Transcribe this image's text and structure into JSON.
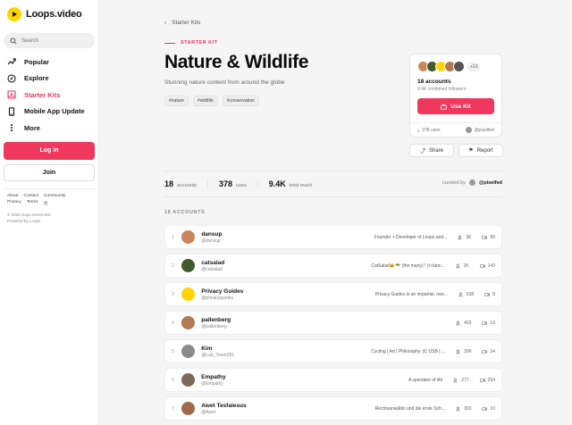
{
  "brand": {
    "name": "Loops.video",
    "accent": "#f0375d",
    "logo_color": "#ffd400"
  },
  "search": {
    "placeholder": "Search"
  },
  "nav": [
    {
      "label": "Popular",
      "icon": "trending-icon"
    },
    {
      "label": "Explore",
      "icon": "compass-icon"
    },
    {
      "label": "Starter Kits",
      "icon": "kit-icon",
      "active": true
    },
    {
      "label": "Mobile App Update",
      "icon": "phone-icon"
    },
    {
      "label": "More",
      "icon": "more-icon"
    }
  ],
  "auth": {
    "login": "Log in",
    "join": "Join"
  },
  "footer": {
    "links": [
      "About",
      "Contact",
      "Community",
      "Privacy",
      "Terms"
    ],
    "copyright": "© 2026 loops.server.test",
    "powered": "Powered by Loops"
  },
  "page": {
    "back": "Starter Kits",
    "kicker": "STARTER KIT",
    "title": "Nature & Wildlife",
    "subtitle": "Stunning nature content from around the globe",
    "tags": [
      "#nature",
      "#wildlife",
      "#conservation"
    ]
  },
  "card": {
    "more": "+13",
    "accounts": "18 accounts",
    "followers": "9.4K combined followers",
    "use_button": "Use Kit",
    "uses": "378 uses",
    "curator": "@pixelfed"
  },
  "actions": {
    "share": "Share",
    "report": "Report"
  },
  "stats": {
    "accounts_value": "18",
    "accounts_label": "accounts",
    "uses_value": "378",
    "uses_label": "uses",
    "reach_value": "9.4K",
    "reach_label": "total reach",
    "curated_label": "curated by",
    "curated_by": "@pixelfed"
  },
  "list": {
    "heading": "18 ACCOUNTS",
    "rows": [
      {
        "num": "1",
        "name": "dansup",
        "handle": "@dansup",
        "bio": "Founder + Developer of Loops and...",
        "followers": "3K",
        "videos": "89",
        "color": "#c8875a"
      },
      {
        "num": "2",
        "name": "catsalad",
        "handle": "@catsalad",
        "bio": "CatSalad🐱🥗 (the many) ! (t r/anc...",
        "followers": "2K",
        "videos": "143",
        "color": "#3f5b2c"
      },
      {
        "num": "3",
        "name": "Privacy Guides",
        "handle": "@privacyguides",
        "bio": "Privacy Guides is an impartial, non...",
        "followers": "638",
        "videos": "8",
        "color": "#ffd400"
      },
      {
        "num": "4",
        "name": "pallenberg",
        "handle": "@pallenberg",
        "bio": "",
        "followers": "403",
        "videos": "19",
        "color": "#b07a55"
      },
      {
        "num": "5",
        "name": "Kim",
        "handle": "@Lab_Team281",
        "bio": "Cycling | Art | Philosophy 🛠 USB | ...",
        "followers": "399",
        "videos": "34",
        "color": "#8a8a8a"
      },
      {
        "num": "6",
        "name": "Empathy",
        "handle": "@Empathy",
        "bio": "A spectator of life",
        "followers": "277",
        "videos": "254",
        "color": "#7d6a5a"
      },
      {
        "num": "7",
        "name": "Awet Tesfaiesus",
        "handle": "@Awet",
        "bio": "Rechtsanwältin und die erste Sch...",
        "followers": "303",
        "videos": "10",
        "color": "#a06a4a"
      }
    ]
  }
}
